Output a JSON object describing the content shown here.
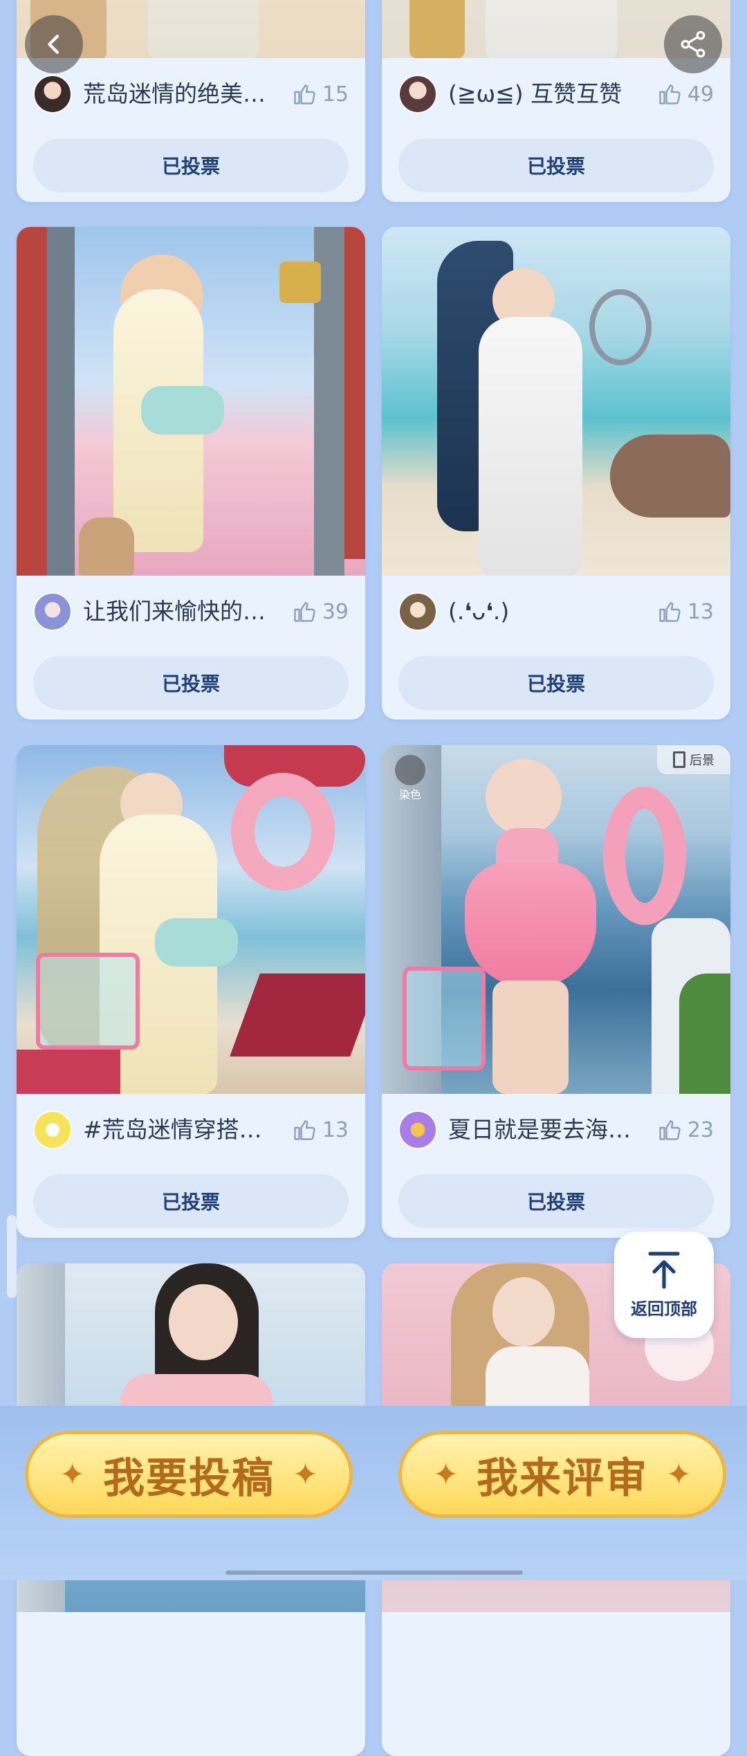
{
  "nav": {
    "back_icon": "chevron-left-icon",
    "share_icon": "share-icon"
  },
  "posts": [
    {
      "title": "荒岛迷情的绝美…",
      "likes": "15",
      "vote_label": "已投票"
    },
    {
      "title": "(≧ω≦) 互赞互赞",
      "likes": "49",
      "vote_label": "已投票"
    },
    {
      "title": "让我们来愉快的…",
      "likes": "39",
      "vote_label": "已投票"
    },
    {
      "title": "(.❛ᴗ❛.)",
      "likes": "13",
      "vote_label": "已投票"
    },
    {
      "title": "#荒岛迷情穿搭…",
      "likes": "13",
      "vote_label": "已投票"
    },
    {
      "title": "夏日就是要去海…",
      "likes": "23",
      "vote_label": "已投票"
    }
  ],
  "image_tags": {
    "dye": "染色",
    "background": "后景"
  },
  "back_to_top": {
    "label": "返回顶部",
    "icon": "arrow-up-icon"
  },
  "actions": {
    "submit": "我要投稿",
    "review": "我来评审"
  },
  "colors": {
    "page_bg": "#b0ccf4",
    "card_bg": "#eaf2fd",
    "vote_bg": "#dbe7f7",
    "vote_text": "#1f3f78",
    "button_gold": "#ffd85a",
    "button_text": "#b36a1b"
  }
}
